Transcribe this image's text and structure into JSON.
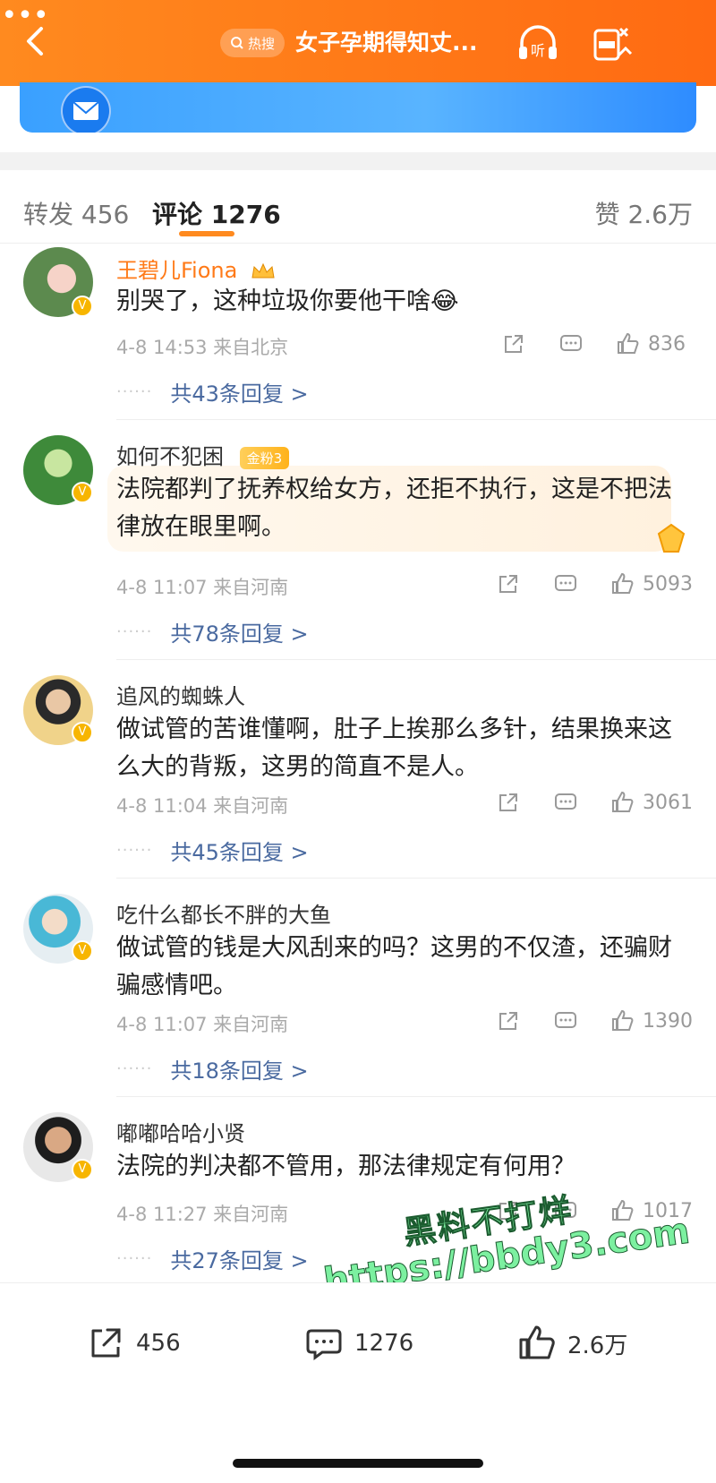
{
  "topbar": {
    "hot_label": "热搜",
    "title": "女子孕期得知丈...",
    "listen_label": "听",
    "more_label": "•••"
  },
  "tabs": {
    "repost": "转发 456",
    "comment": "评论 1276",
    "like": "赞 2.6万"
  },
  "comments": [
    {
      "name": "王碧儿Fiona",
      "text": "别哭了，这种垃圾你要他干啥",
      "emoji": "😂",
      "time_location": "4-8 14:53  来自北京",
      "likes": "836",
      "replies": "共43条回复 >"
    },
    {
      "name": "如何不犯困",
      "fan_badge": "金粉3",
      "text": "法院都判了抚养权给女方，还拒不执行，这是不把法律放在眼里啊。",
      "time_location": "4-8 11:07  来自河南",
      "likes": "5093",
      "replies": "共78条回复 >"
    },
    {
      "name": "追风的蜘蛛人",
      "text": "做试管的苦谁懂啊，肚子上挨那么多针，结果换来这么大的背叛，这男的简直不是人。",
      "time_location": "4-8 11:04  来自河南",
      "likes": "3061",
      "replies": "共45条回复 >"
    },
    {
      "name": "吃什么都长不胖的大鱼",
      "text": "做试管的钱是大风刮来的吗？这男的不仅渣，还骗财骗感情吧。",
      "time_location": "4-8 11:07  来自河南",
      "likes": "1390",
      "replies": "共18条回复 >"
    },
    {
      "name": "嘟嘟哈哈小贤",
      "text": "法院的判决都不管用，那法律规定有何用？",
      "time_location": "4-8 11:27  来自河南",
      "likes": "1017",
      "replies": "共27条回复 >"
    }
  ],
  "bottom": {
    "repost": "456",
    "comment": "1276",
    "like": "2.6万"
  },
  "watermark": {
    "line1": "黑料不打烊",
    "line2": "https://bbdy3.com"
  },
  "colors": {
    "accent": "#ff8a1f",
    "link": "#4a6aa0",
    "vip_name": "#ff7a18"
  }
}
